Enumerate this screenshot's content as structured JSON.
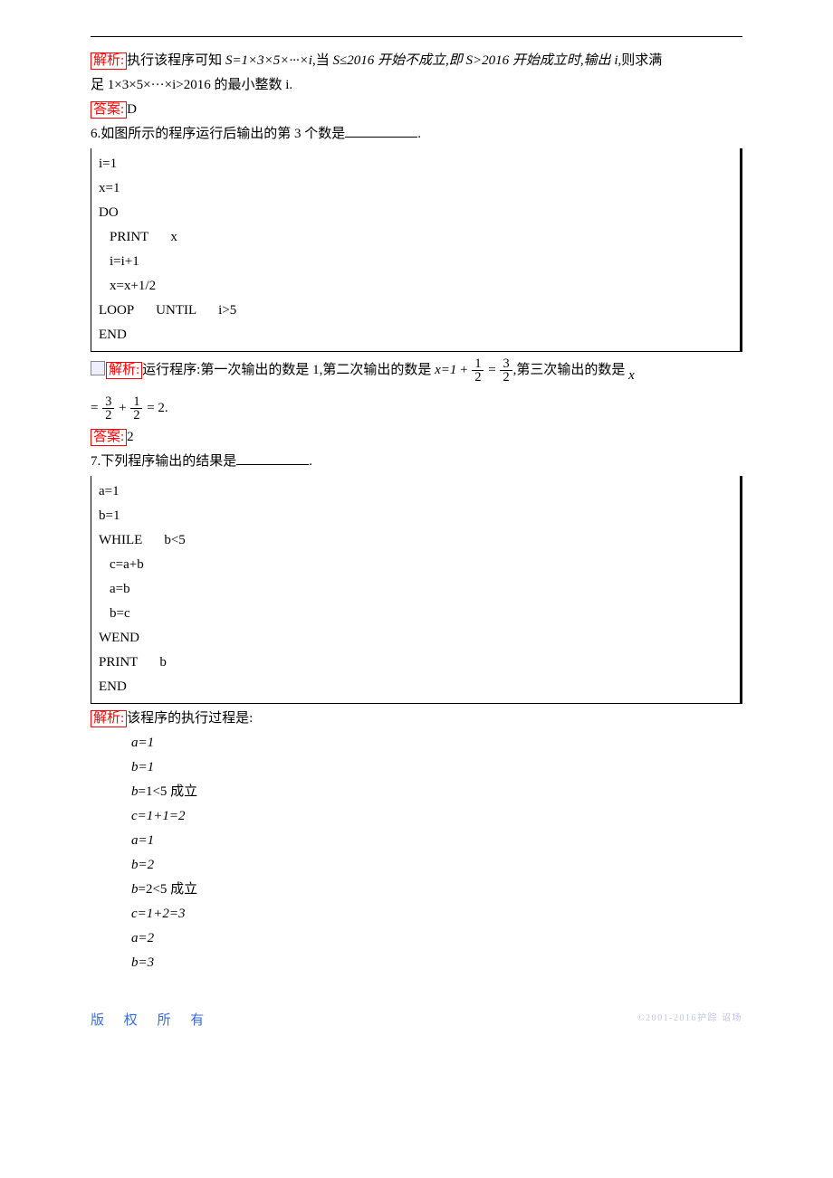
{
  "q5": {
    "analysis_label": "解析:",
    "analysis1": "执行该程序可知 ",
    "analysis2": "S=1×3×5×···×i,",
    "analysis3": "当 ",
    "analysis4": "S≤2016 开始不成立,即 S>2016 开始成立时,输出 i,",
    "analysis5": "则求满",
    "analysis6": "足 1×3×5×···×i>2016 的最小整数 i.",
    "answer_label": "答案:",
    "answer": "D"
  },
  "q6": {
    "stem": "6.如图所示的程序运行后输出的第 3 个数是",
    "period": ".",
    "code": [
      "i=1",
      "x=1",
      "DO",
      "  PRINT   x",
      "  i=i+1",
      "  x=x+1/2",
      "LOOP   UNTIL   i>5",
      "END"
    ],
    "analysis_label": "解析:",
    "ana_a": "运行程序:第一次输出的数是 1,第二次输出的数是 ",
    "ana_b": "x=1",
    "ana_c": "第三次输出的数是",
    "ana_d": "x",
    "eq2_tail": "= 2.",
    "answer_label": "答案:",
    "answer": "2"
  },
  "q7": {
    "stem": "7.下列程序输出的结果是",
    "period": ".",
    "code": [
      "a=1",
      "b=1",
      "WHILE   b<5",
      "  c=a+b",
      "  a=b",
      "  b=c",
      "WEND",
      "PRINT   b",
      "END"
    ],
    "analysis_label": "解析:",
    "analysis_text": "该程序的执行过程是:",
    "trace": [
      "a=1",
      "b=1",
      "b=1<5 成立",
      "c=1+1=2",
      "a=1",
      "b=2",
      "b=2<5 成立",
      "c=1+2=3",
      "a=2",
      "b=3"
    ]
  },
  "fractions": {
    "half_num": "1",
    "half_den": "2",
    "threehalf_num": "3",
    "threehalf_den": "2"
  },
  "footer": {
    "left": "版 权 所 有",
    "right": "©2001-2016护踪 诏场"
  }
}
